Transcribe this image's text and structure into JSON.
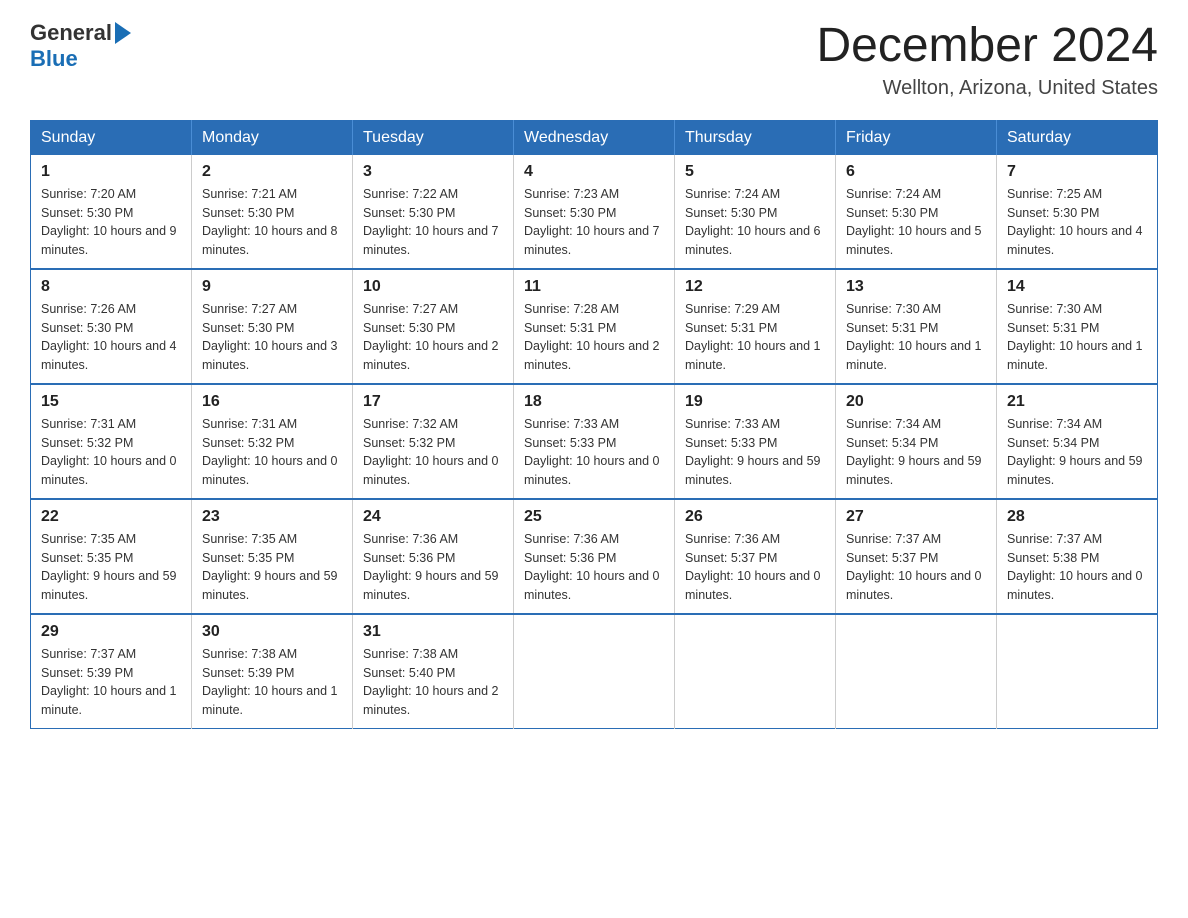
{
  "logo": {
    "text_general": "General",
    "text_blue": "Blue"
  },
  "header": {
    "month_year": "December 2024",
    "location": "Wellton, Arizona, United States"
  },
  "days_of_week": [
    "Sunday",
    "Monday",
    "Tuesday",
    "Wednesday",
    "Thursday",
    "Friday",
    "Saturday"
  ],
  "weeks": [
    [
      {
        "day": "1",
        "sunrise": "7:20 AM",
        "sunset": "5:30 PM",
        "daylight": "10 hours and 9 minutes."
      },
      {
        "day": "2",
        "sunrise": "7:21 AM",
        "sunset": "5:30 PM",
        "daylight": "10 hours and 8 minutes."
      },
      {
        "day": "3",
        "sunrise": "7:22 AM",
        "sunset": "5:30 PM",
        "daylight": "10 hours and 7 minutes."
      },
      {
        "day": "4",
        "sunrise": "7:23 AM",
        "sunset": "5:30 PM",
        "daylight": "10 hours and 7 minutes."
      },
      {
        "day": "5",
        "sunrise": "7:24 AM",
        "sunset": "5:30 PM",
        "daylight": "10 hours and 6 minutes."
      },
      {
        "day": "6",
        "sunrise": "7:24 AM",
        "sunset": "5:30 PM",
        "daylight": "10 hours and 5 minutes."
      },
      {
        "day": "7",
        "sunrise": "7:25 AM",
        "sunset": "5:30 PM",
        "daylight": "10 hours and 4 minutes."
      }
    ],
    [
      {
        "day": "8",
        "sunrise": "7:26 AM",
        "sunset": "5:30 PM",
        "daylight": "10 hours and 4 minutes."
      },
      {
        "day": "9",
        "sunrise": "7:27 AM",
        "sunset": "5:30 PM",
        "daylight": "10 hours and 3 minutes."
      },
      {
        "day": "10",
        "sunrise": "7:27 AM",
        "sunset": "5:30 PM",
        "daylight": "10 hours and 2 minutes."
      },
      {
        "day": "11",
        "sunrise": "7:28 AM",
        "sunset": "5:31 PM",
        "daylight": "10 hours and 2 minutes."
      },
      {
        "day": "12",
        "sunrise": "7:29 AM",
        "sunset": "5:31 PM",
        "daylight": "10 hours and 1 minute."
      },
      {
        "day": "13",
        "sunrise": "7:30 AM",
        "sunset": "5:31 PM",
        "daylight": "10 hours and 1 minute."
      },
      {
        "day": "14",
        "sunrise": "7:30 AM",
        "sunset": "5:31 PM",
        "daylight": "10 hours and 1 minute."
      }
    ],
    [
      {
        "day": "15",
        "sunrise": "7:31 AM",
        "sunset": "5:32 PM",
        "daylight": "10 hours and 0 minutes."
      },
      {
        "day": "16",
        "sunrise": "7:31 AM",
        "sunset": "5:32 PM",
        "daylight": "10 hours and 0 minutes."
      },
      {
        "day": "17",
        "sunrise": "7:32 AM",
        "sunset": "5:32 PM",
        "daylight": "10 hours and 0 minutes."
      },
      {
        "day": "18",
        "sunrise": "7:33 AM",
        "sunset": "5:33 PM",
        "daylight": "10 hours and 0 minutes."
      },
      {
        "day": "19",
        "sunrise": "7:33 AM",
        "sunset": "5:33 PM",
        "daylight": "9 hours and 59 minutes."
      },
      {
        "day": "20",
        "sunrise": "7:34 AM",
        "sunset": "5:34 PM",
        "daylight": "9 hours and 59 minutes."
      },
      {
        "day": "21",
        "sunrise": "7:34 AM",
        "sunset": "5:34 PM",
        "daylight": "9 hours and 59 minutes."
      }
    ],
    [
      {
        "day": "22",
        "sunrise": "7:35 AM",
        "sunset": "5:35 PM",
        "daylight": "9 hours and 59 minutes."
      },
      {
        "day": "23",
        "sunrise": "7:35 AM",
        "sunset": "5:35 PM",
        "daylight": "9 hours and 59 minutes."
      },
      {
        "day": "24",
        "sunrise": "7:36 AM",
        "sunset": "5:36 PM",
        "daylight": "9 hours and 59 minutes."
      },
      {
        "day": "25",
        "sunrise": "7:36 AM",
        "sunset": "5:36 PM",
        "daylight": "10 hours and 0 minutes."
      },
      {
        "day": "26",
        "sunrise": "7:36 AM",
        "sunset": "5:37 PM",
        "daylight": "10 hours and 0 minutes."
      },
      {
        "day": "27",
        "sunrise": "7:37 AM",
        "sunset": "5:37 PM",
        "daylight": "10 hours and 0 minutes."
      },
      {
        "day": "28",
        "sunrise": "7:37 AM",
        "sunset": "5:38 PM",
        "daylight": "10 hours and 0 minutes."
      }
    ],
    [
      {
        "day": "29",
        "sunrise": "7:37 AM",
        "sunset": "5:39 PM",
        "daylight": "10 hours and 1 minute."
      },
      {
        "day": "30",
        "sunrise": "7:38 AM",
        "sunset": "5:39 PM",
        "daylight": "10 hours and 1 minute."
      },
      {
        "day": "31",
        "sunrise": "7:38 AM",
        "sunset": "5:40 PM",
        "daylight": "10 hours and 2 minutes."
      },
      null,
      null,
      null,
      null
    ]
  ],
  "labels": {
    "sunrise": "Sunrise:",
    "sunset": "Sunset:",
    "daylight": "Daylight:"
  }
}
